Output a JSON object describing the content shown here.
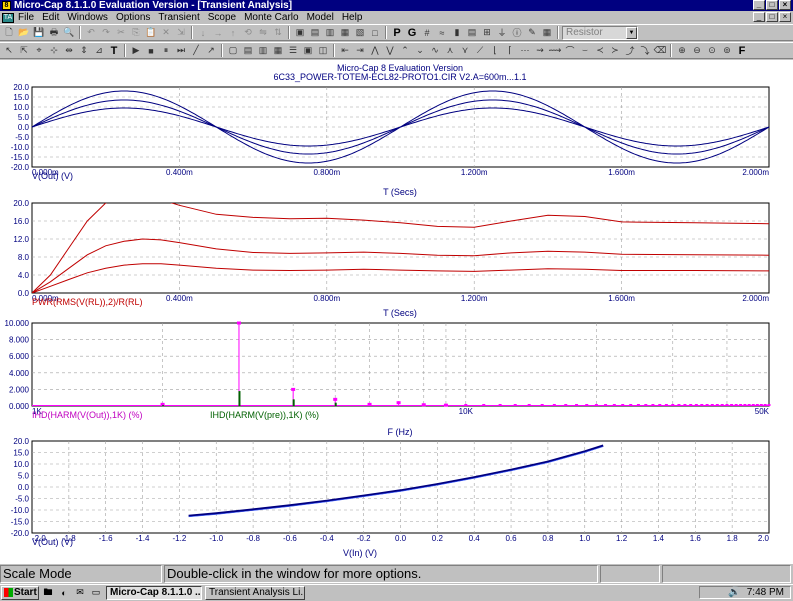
{
  "window": {
    "app_icon": "8",
    "title": "Micro-Cap 8.1.1.0 Evaluation Version - [Transient Analysis]",
    "controls": [
      "_",
      "□",
      "×"
    ]
  },
  "menu": {
    "doc_icon": "TA",
    "items": [
      "File",
      "Edit",
      "Windows",
      "Options",
      "Transient",
      "Scope",
      "Monte Carlo",
      "Model",
      "Help"
    ]
  },
  "toolbar": {
    "component_combo": "Resistor",
    "p_label": "P",
    "g_label": "G",
    "f_label": "F",
    "text_tool": "T"
  },
  "plot_header": {
    "version": "Micro-Cap 8 Evaluation Version",
    "circuit": "6C33_POWER-TOTEM-ECL82-PROTO1.CIR V2.A=600m...1.1"
  },
  "colors": {
    "blue_trace": "#000080",
    "red_trace": "#c00000",
    "magenta_trace": "#ff00ff",
    "green_trace": "#006000",
    "grid": "#a0a0a0"
  },
  "chart_data": [
    {
      "type": "line",
      "expression": "V(Out) (V)",
      "xlabel": "T (Secs)",
      "x_ticks": [
        "0.000m",
        "0.400m",
        "0.800m",
        "1.200m",
        "1.600m",
        "2.000m"
      ],
      "y_ticks": [
        "20.0",
        "15.0",
        "10.0",
        "5.0",
        "0.0",
        "-5.0",
        "-10.0",
        "-15.0",
        "-20.0"
      ],
      "xlim": [
        0,
        2.0
      ],
      "ylim": [
        -20,
        20
      ],
      "series": [
        {
          "amplitude": 18,
          "frequency_khz": 1
        },
        {
          "amplitude": 13.5,
          "frequency_khz": 1
        },
        {
          "amplitude": 9.5,
          "frequency_khz": 1
        }
      ]
    },
    {
      "type": "line",
      "expression": "PWR(RMS(V(RL)),2)/R(RL)",
      "xlabel": "T (Secs)",
      "x_ticks": [
        "0.000m",
        "0.400m",
        "0.800m",
        "1.200m",
        "1.600m",
        "2.000m"
      ],
      "y_ticks": [
        "20.0",
        "16.0",
        "12.0",
        "8.0",
        "4.0",
        "0.0"
      ],
      "xlim": [
        0,
        2.0
      ],
      "ylim": [
        0,
        20
      ],
      "series": [
        {
          "x": [
            0,
            0.05,
            0.1,
            0.15,
            0.2,
            0.25,
            0.3,
            0.4,
            0.5,
            0.6,
            0.7,
            0.8,
            0.9,
            1.0,
            1.1,
            1.2,
            1.3,
            1.4,
            1.5,
            1.6,
            1.8,
            2.0
          ],
          "y": [
            0,
            4,
            10,
            16,
            20,
            22,
            22,
            19.5,
            17.5,
            16.8,
            16.5,
            16.6,
            16.2,
            15.6,
            14.8,
            14.6,
            16,
            17.3,
            17,
            15.8,
            15.6,
            15.4
          ]
        },
        {
          "x": [
            0,
            0.05,
            0.1,
            0.15,
            0.2,
            0.25,
            0.3,
            0.35,
            0.4,
            0.5,
            0.6,
            0.7,
            0.8,
            0.9,
            1.0,
            1.1,
            1.2,
            1.3,
            1.4,
            1.5,
            1.6,
            1.8,
            2.0
          ],
          "y": [
            0,
            2.5,
            5.5,
            8.5,
            10.5,
            11.5,
            12,
            11.8,
            11.2,
            9.8,
            9,
            8.8,
            8.9,
            9.1,
            8.8,
            8.4,
            8.3,
            8.9,
            9.3,
            9.1,
            8.6,
            8.5,
            8.4
          ]
        },
        {
          "x": [
            0,
            0.05,
            0.1,
            0.15,
            0.2,
            0.25,
            0.3,
            0.35,
            0.4,
            0.5,
            0.6,
            0.7,
            0.8,
            0.9,
            1.0,
            1.1,
            1.2,
            1.3,
            1.4,
            1.5,
            1.6,
            1.8,
            2.0
          ],
          "y": [
            0,
            1.5,
            3,
            4.5,
            5.5,
            6.2,
            6.5,
            6.5,
            6.2,
            5.5,
            5.1,
            5,
            5.1,
            5.3,
            5.1,
            4.9,
            4.8,
            5.1,
            5.4,
            5.3,
            5,
            5,
            4.9
          ]
        }
      ]
    },
    {
      "type": "bar",
      "expressions": [
        "IHD(HARM(V(Out)),1K) (%)",
        "IHD(HARM(V(pre)),1K) (%)"
      ],
      "xlabel": "F (Hz)",
      "x_scale": "log",
      "x_ticks": [
        "1K",
        "10K",
        "50K"
      ],
      "y_ticks": [
        "10.000",
        "8.000",
        "6.000",
        "4.000",
        "2.000",
        "0.000"
      ],
      "xlim": [
        1000,
        50000
      ],
      "ylim": [
        0,
        10
      ],
      "series": [
        {
          "name": "IHD(HARM(V(Out)),1K) (%)",
          "x": [
            2000,
            3000,
            4000,
            5000,
            6000,
            7000,
            8000,
            9000
          ],
          "y": [
            0.2,
            10.0,
            2.0,
            0.8,
            0.2,
            0.4,
            0.15,
            0.1
          ]
        },
        {
          "name": "IHD(HARM(V(pre)),1K) (%)",
          "x": [
            2000,
            3000,
            4000,
            5000
          ],
          "y": [
            0.1,
            1.8,
            0.8,
            0.4
          ]
        }
      ]
    },
    {
      "type": "scatter",
      "expression": "V(Out) (V)",
      "xlabel": "V(In) (V)",
      "x_ticks": [
        "-2.0",
        "-1.8",
        "-1.6",
        "-1.4",
        "-1.2",
        "-1.0",
        "-0.8",
        "-0.6",
        "-0.4",
        "-0.2",
        "0.0",
        "0.2",
        "0.4",
        "0.6",
        "0.8",
        "1.0",
        "1.2",
        "1.4",
        "1.6",
        "1.8",
        "2.0"
      ],
      "y_ticks": [
        "20.0",
        "15.0",
        "10.0",
        "5.0",
        "0.0",
        "-5.0",
        "-10.0",
        "-15.0",
        "-20.0"
      ],
      "xlim": [
        -2,
        2
      ],
      "ylim": [
        -20,
        20
      ],
      "series": [
        {
          "x": [
            -1.15,
            -1.0,
            -0.8,
            -0.6,
            -0.4,
            -0.2,
            0.0,
            0.2,
            0.4,
            0.6,
            0.8,
            1.0,
            1.1
          ],
          "y": [
            -12.5,
            -11.5,
            -9.8,
            -8.0,
            -6.0,
            -3.8,
            -1.5,
            1.2,
            4.2,
            7.5,
            11.0,
            15.5,
            18.0
          ]
        }
      ]
    }
  ],
  "status": {
    "mode": "Scale Mode",
    "hint": "Double-click in the window for more options."
  },
  "taskbar": {
    "start": "Start",
    "tasks": [
      "Micro-Cap 8.1.1.0 ...",
      "Transient Analysis Li..."
    ],
    "time": "7:48 PM"
  }
}
